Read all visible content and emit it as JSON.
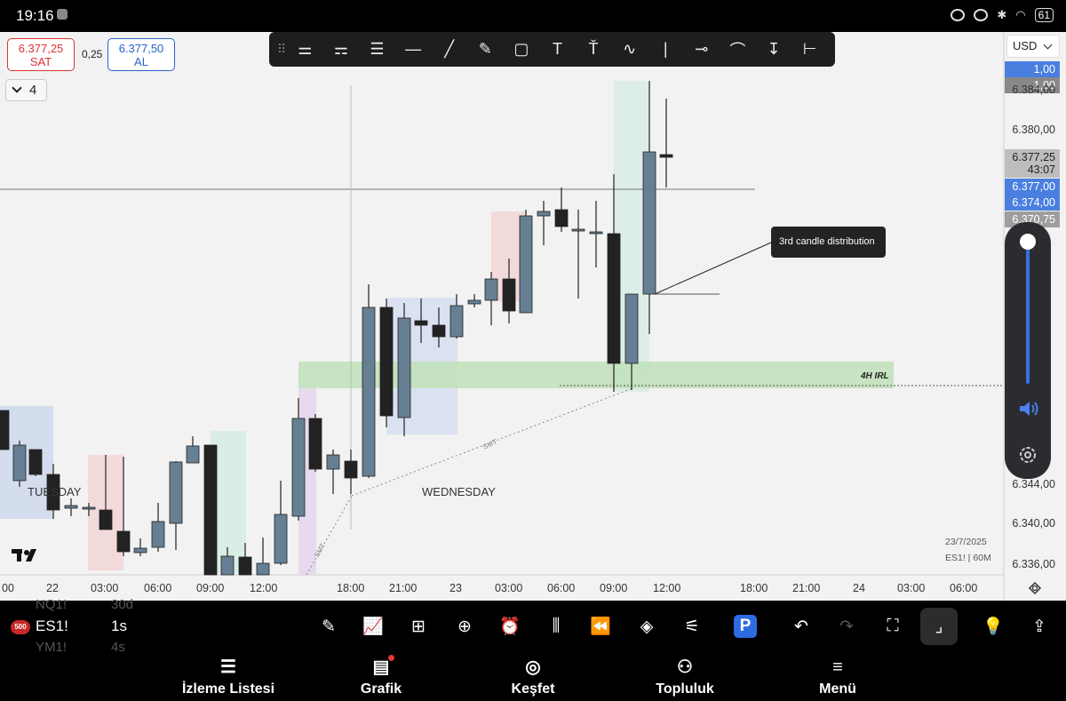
{
  "status_bar": {
    "time": "19:16",
    "battery": "61"
  },
  "quote": {
    "sell_price": "6.377,25",
    "sell_label": "SAT",
    "spread": "0,25",
    "buy_price": "6.377,50",
    "buy_label": "AL",
    "layout_count": "4"
  },
  "currency": "USD",
  "drawing_tools": [
    "multi-level-lines-icon",
    "fib-lines-icon",
    "horizontal-lines-icon",
    "horizontal-ray-icon",
    "trend-line-icon",
    "brush-icon",
    "rectangle-icon",
    "text-icon",
    "text-box-icon",
    "path-icon",
    "vertical-line-icon",
    "horizontal-segment-icon",
    "curve-icon",
    "price-range-icon",
    "date-range-icon"
  ],
  "price_axis": [
    {
      "text": "1,00",
      "bg": "#4a7fe0",
      "fg": "#ffffff"
    },
    {
      "text": "1,00",
      "bg": "#888888",
      "fg": "#ffffff"
    },
    {
      "text": "6.384,00",
      "bg": "",
      "fg": "#333333"
    },
    {
      "text": "6.380,00",
      "bg": "",
      "fg": "#333333"
    },
    {
      "text": "6.377,25",
      "bg": "#bdbdbd",
      "fg": "#222222"
    },
    {
      "text": "43:07",
      "bg": "#bdbdbd",
      "fg": "#222222"
    },
    {
      "text": "6.377,00",
      "bg": "#4a7fe0",
      "fg": "#ffffff"
    },
    {
      "text": "6.374,00",
      "bg": "#4a7fe0",
      "fg": "#ffffff"
    },
    {
      "text": "6.370,75",
      "bg": "#9e9e9e",
      "fg": "#ffffff"
    },
    {
      "text": "6.344,00",
      "bg": "",
      "fg": "#333333"
    },
    {
      "text": "6.340,00",
      "bg": "",
      "fg": "#333333"
    },
    {
      "text": "6.336,00",
      "bg": "",
      "fg": "#333333"
    }
  ],
  "time_axis": [
    "00",
    "22",
    "03:00",
    "06:00",
    "09:00",
    "12:00",
    "18:00",
    "21:00",
    "23",
    "03:00",
    "06:00",
    "09:00",
    "12:00",
    "18:00",
    "21:00",
    "24",
    "03:00",
    "06:00"
  ],
  "annotations": {
    "tooltip": "3rd candle distribution",
    "zone_label": "4H IRL",
    "smt_1": "SMT",
    "smt_2": "SMT",
    "day_1": "TUESDAY",
    "day_2": "WEDNESDAY",
    "date_stamp": "23/7/2025",
    "symbol_stamp": "ES1! | 60M"
  },
  "symbol_bar": {
    "badge": "500",
    "symbol": "ES1!",
    "interval": "1s",
    "ghost_above_symbol": "NQ1!",
    "ghost_above_interval": "30d",
    "ghost_below_symbol": "YM1!",
    "ghost_below_interval": "4s"
  },
  "bottom_tools": [
    "pencil-icon",
    "indicators-icon",
    "templates-icon",
    "add-icon",
    "alert-icon",
    "candle-type-icon",
    "replay-icon",
    "layers-icon",
    "settings-sliders-icon",
    "broker-icon",
    "undo-icon",
    "redo-icon",
    "fullscreen-icon",
    "collapse-icon",
    "bulb-icon",
    "share-icon"
  ],
  "nav": [
    {
      "label": "İzleme Listesi",
      "icon": "watchlist-icon"
    },
    {
      "label": "Grafik",
      "icon": "chart-icon"
    },
    {
      "label": "Keşfet",
      "icon": "compass-icon"
    },
    {
      "label": "Topluluk",
      "icon": "community-icon"
    },
    {
      "label": "Menü",
      "icon": "menu-icon"
    }
  ]
}
